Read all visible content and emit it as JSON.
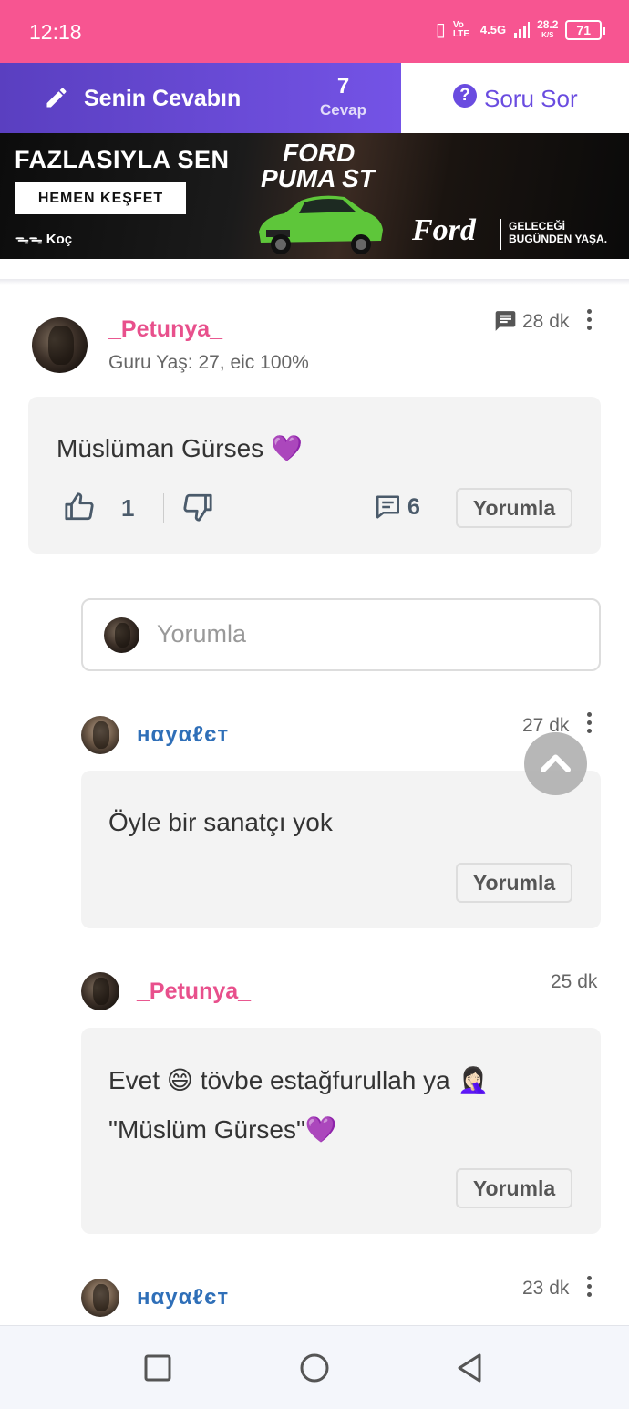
{
  "status_bar": {
    "time": "12:18",
    "net_type": "4.5G",
    "speed": "28.2",
    "speed_unit": "K/S",
    "volte": "Vo LTE",
    "battery": "71"
  },
  "action_bar": {
    "answer_label": "Senin Cevabın",
    "answer_count": "7",
    "answer_count_label": "Cevap",
    "ask_label": "Soru Sor"
  },
  "ad": {
    "headline": "FAZLASIYLA SEN",
    "cta": "HEMEN KEŞFET",
    "brand_group": "Koç",
    "model_line1": "FORD",
    "model_line2": "PUMA ST",
    "brand": "Ford",
    "slogan_line1": "GELECEĞİ",
    "slogan_line2": "BUGÜNDEN YAŞA."
  },
  "answer": {
    "username": "_Petunya_",
    "meta": "Guru Yaş: 27, eic 100%",
    "time": "28 dk",
    "text": "Müslüman Gürses 💜",
    "likes": "1",
    "comment_count": "6",
    "comment_button": "Yorumla"
  },
  "comment_input": {
    "placeholder": "Yorumla"
  },
  "comments": [
    {
      "username": "нαуαℓєт",
      "time": "27 dk",
      "text": "Öyle bir sanatçı yok",
      "button": "Yorumla"
    },
    {
      "username": "_Petunya_",
      "time": "25 dk",
      "text_line1": "Evet 😄 tövbe estağfurullah ya 🤦🏻‍♀️",
      "text_line2": "\"Müslüm Gürses\"💜",
      "button": "Yorumla"
    },
    {
      "username": "нαуαℓєт",
      "time": "23 dk"
    }
  ],
  "colors": {
    "status_bar": "#f75591",
    "accent_purple": "#6a4ce0",
    "username_pink": "#e8508c",
    "username_blue": "#2f6fb8"
  },
  "icons": {
    "pen": "pencil-icon",
    "question": "question-circle-icon",
    "comment": "comment-icon",
    "like": "thumbs-up-icon",
    "dislike": "thumbs-down-icon",
    "more": "kebab-icon",
    "scroll_top": "chevron-up-icon"
  }
}
